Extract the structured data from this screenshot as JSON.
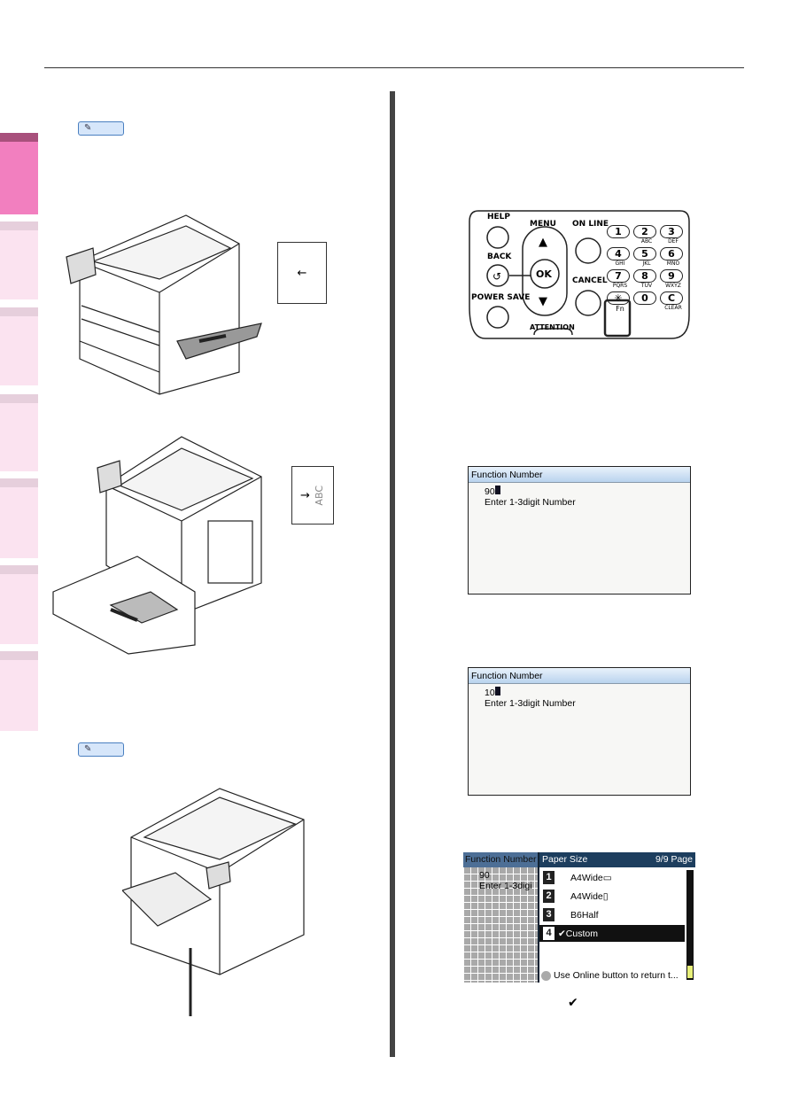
{
  "sidebar": {
    "tabs": [
      {
        "active": true
      },
      {
        "active": false
      },
      {
        "active": false
      },
      {
        "active": false
      },
      {
        "active": false
      },
      {
        "active": false
      },
      {
        "active": false
      }
    ],
    "accent": "#f27fbf"
  },
  "memo_label": "",
  "paper_diagrams": [
    {
      "arrow": "←",
      "text": ""
    },
    {
      "arrow": "→",
      "text": "ABC"
    }
  ],
  "control_panel": {
    "help": "HELP",
    "menu": "MENU",
    "online": "ON LINE",
    "back": "BACK",
    "ok": "OK",
    "cancel": "CANCEL",
    "power_save": "POWER SAVE",
    "attention": "ATTENTION",
    "keys": [
      {
        "k": "1",
        "s": ""
      },
      {
        "k": "2",
        "s": "ABC"
      },
      {
        "k": "3",
        "s": "DEF"
      },
      {
        "k": "4",
        "s": "GHI"
      },
      {
        "k": "5",
        "s": "JKL"
      },
      {
        "k": "6",
        "s": "MNO"
      },
      {
        "k": "7",
        "s": "PQRS"
      },
      {
        "k": "8",
        "s": "TUV"
      },
      {
        "k": "9",
        "s": "WXYZ"
      },
      {
        "k": "✳",
        "s": "Fn"
      },
      {
        "k": "0",
        "s": ""
      },
      {
        "k": "C",
        "s": "CLEAR"
      }
    ]
  },
  "screen1": {
    "title": "Function Number",
    "value": "90",
    "hint": "Enter 1-3digit Number"
  },
  "screen2": {
    "title": "Function Number",
    "value": "10",
    "hint": "Enter 1-3digit Number"
  },
  "screen3": {
    "left_title": "Function Number",
    "left_value": "90",
    "left_hint": "Enter 1-3digi",
    "title": "Paper Size",
    "page": "9/9 Page",
    "items": [
      {
        "n": "1",
        "label": "A4Wide▭"
      },
      {
        "n": "2",
        "label": "A4Wide▯"
      },
      {
        "n": "3",
        "label": "B6Half"
      },
      {
        "n": "4",
        "label": "✔Custom"
      }
    ],
    "footer": "Use Online button to return t..."
  },
  "check_mark": "✔"
}
